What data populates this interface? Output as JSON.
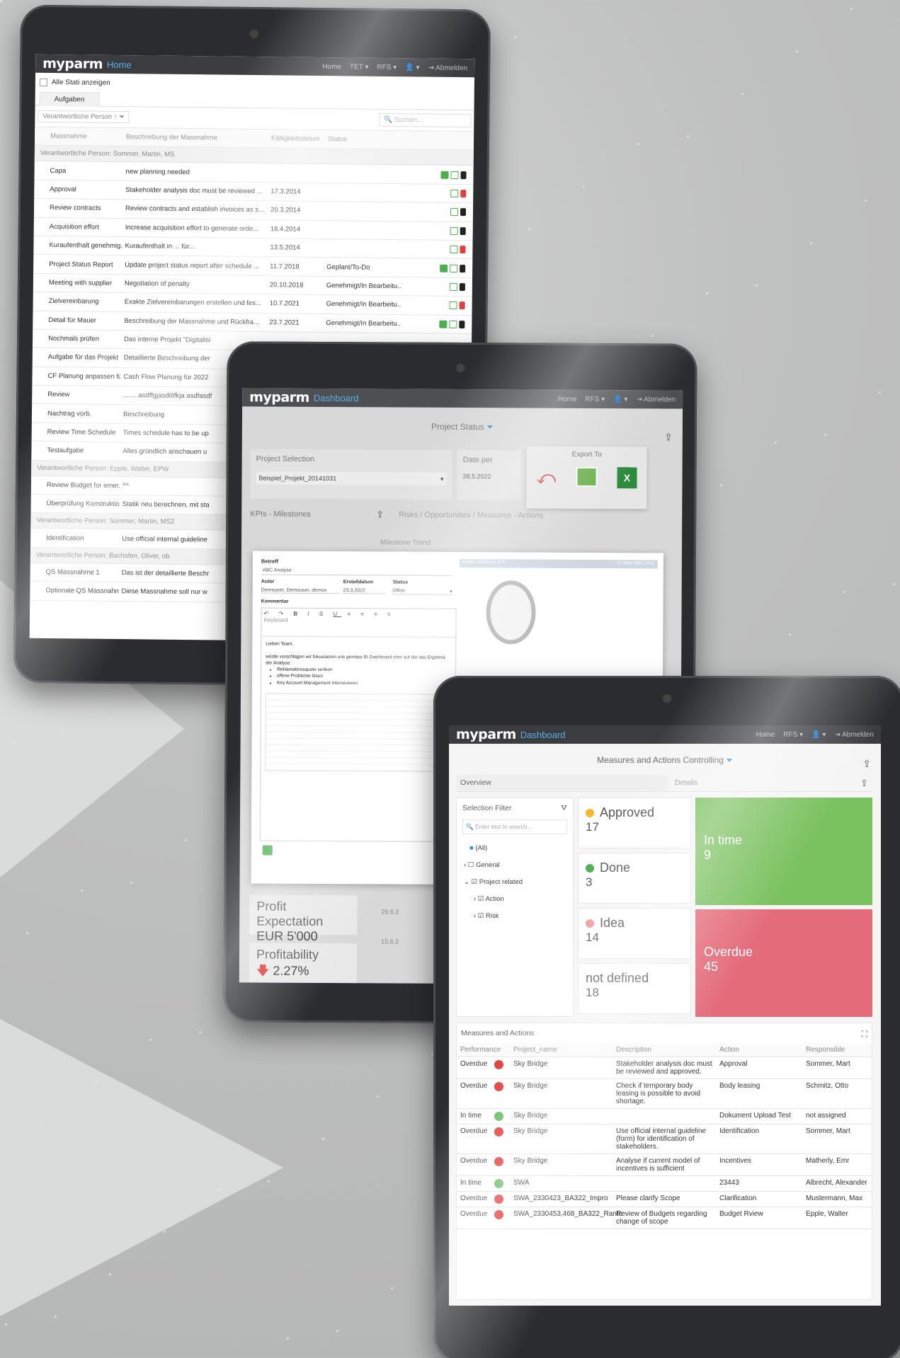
{
  "brand": {
    "logo": "myparm"
  },
  "tablet1": {
    "title": "Home",
    "nav": [
      "Home",
      "TET ▾",
      "RFS ▾",
      "👤 ▾",
      "⇥ Abmelden"
    ],
    "show_all": "Alle Stati anzeigen",
    "tab": "Aufgaben",
    "group_by": "Verantwortliche Person",
    "search_placeholder": "Suchen...",
    "columns": [
      "Massnahme",
      "Beschreibung der Massnahme",
      "Fälligkeitsdatum",
      "Status"
    ],
    "groups": [
      {
        "label": "Verantwortliche Person: Sommer, Martin, MS",
        "rows": [
          [
            "Capa",
            "new planning needed",
            "",
            ""
          ],
          [
            "Approval",
            "Stakeholder analysis doc must be reviewed ...",
            "17.3.2014",
            ""
          ],
          [
            "Review contracts",
            "Review contracts and establish invoices as s...",
            "20.3.2014",
            ""
          ],
          [
            "Acquisition effort",
            "Increase acquisition effort to generate orde...",
            "18.4.2014",
            ""
          ],
          [
            "Kuraufenthalt genehmig...",
            "Kuraufenthalt in ... für...",
            "13.5.2014",
            ""
          ],
          [
            "Project Status Report",
            "Update project status report after schedule ...",
            "11.7.2018",
            "Geplant/To-Do"
          ],
          [
            "Meeting with supplier",
            "Negotiation of penalty",
            "20.10.2018",
            "Genehmigt/In Bearbeitu..."
          ],
          [
            "Zielvereinbarung",
            "Exakte Zielvereinbarungen erstellen und fes...",
            "10.7.2021",
            "Genehmigt/In Bearbeitu..."
          ],
          [
            "Detail für Mauer",
            "Beschreibung der Massnahme und Rückfra...",
            "23.7.2021",
            "Genehmigt/In Bearbeitu..."
          ],
          [
            "Nochmals prüfen",
            "Das interne Projekt \"Digitalisi",
            "",
            ""
          ],
          [
            "Aufgabe für das Projekt",
            "Detaillierte Beschreibung der",
            "",
            ""
          ],
          [
            "CF Planung anpassen fü...",
            "Cash Flow Planung für 2022",
            "",
            ""
          ],
          [
            "Review",
            "........asdffgjasdölfkja asdfasdf",
            "",
            ""
          ],
          [
            "Nachtrag vorb.",
            "Beschreibung",
            "",
            ""
          ],
          [
            "Review Time Schedule",
            "Times schedule has to be up",
            "",
            ""
          ],
          [
            "Testaufgabe",
            "Alles gründlich anschauen u",
            "",
            ""
          ]
        ]
      },
      {
        "label": "Verantwortliche Person: Epple, Walter, EPW",
        "rows": [
          [
            "Review Budget for emer...",
            "^^",
            "",
            ""
          ],
          [
            "Überprüfung Konstruktion",
            "Statik neu berechnen, mit sta",
            "",
            ""
          ]
        ]
      },
      {
        "label": "Verantwortliche Person: Sommer, Martin, MS2",
        "rows": [
          [
            "Identification",
            "Use official internal guideline",
            "",
            ""
          ]
        ]
      },
      {
        "label": "Verantwortliche Person: Bachofen, Oliver, ob",
        "rows": [
          [
            "QS Massnahme 1",
            "Das ist der detaillierte Beschr",
            "",
            ""
          ],
          [
            "Optionale QS Massnahme",
            "Diese Massnahme soll nur w",
            "",
            ""
          ]
        ]
      }
    ]
  },
  "tablet2": {
    "title": "Dashboard",
    "nav": [
      "Home",
      "RFS ▾",
      "👤 ▾",
      "⇥ Abmelden"
    ],
    "heading": "Project Status",
    "project_selection_label": "Project Selection",
    "project_value": "Beispiel_Projekt_20141031",
    "date_label": "Date per",
    "date_value": "28.5.2022",
    "export_label": "Export To",
    "kpi_label": "KPIs - Milestones",
    "risks_label": "Risks / Opportunities / Measures - Actions",
    "trend_label": "Milestone Trend",
    "form": {
      "betreff_label": "Betreff",
      "betreff_value": "ABC Analyse",
      "autor_label": "Autor",
      "autor_value": "Demouser, Demouser, demox",
      "datum_label": "Erstelldatum",
      "datum_value": "23.3.2022",
      "status_label": "Status",
      "status_value": "Offen",
      "kommentar_label": "Kommentar",
      "keyboard": "Keyboard",
      "text_greeting": "Lieben Team,",
      "text_body": "würde vorschlagen wir fokussieren uns gemäss BI Dashboard eher auf die das Ergebnis der Analyse:",
      "bullets": [
        "Reklamationsquote senken",
        "offene Probleme lösen",
        "Key Account Management intensivieren"
      ]
    },
    "image_caption": "Pfeiffer, Elisabeth, EPF",
    "image_date": "21 März 2022 14:41",
    "profit_label": "Profit Expectation",
    "profit_value": "EUR 5'000",
    "profitability_label": "Profitability",
    "profitability_value": "2.27%",
    "side_dates": [
      "29.6.2",
      "15.6.2"
    ]
  },
  "tablet3": {
    "title": "Dashboard",
    "nav": [
      "Home",
      "RFS ▾",
      "👤 ▾",
      "⇥ Abmelden"
    ],
    "heading": "Measures and Actions Controlling",
    "tab_overview": "Overview",
    "tab_details": "Details",
    "filter_label": "Selection Filter",
    "search_placeholder": "Enter text to search...",
    "tree": [
      "(All)",
      "General",
      "Project related",
      "Action",
      "Risk"
    ],
    "kpis": [
      {
        "label": "Approved",
        "value": "17",
        "color": "#f5b82e"
      },
      {
        "label": "Done",
        "value": "3",
        "color": "#4caf50"
      },
      {
        "label": "Idea",
        "value": "14",
        "color": "#f09aa0"
      },
      {
        "label": "not defined",
        "value": "18",
        "color": ""
      }
    ],
    "tiles": [
      {
        "label": "In time",
        "value": "9",
        "color": "#7ac15f"
      },
      {
        "label": "Overdue",
        "value": "45",
        "color": "#e46c7a"
      }
    ],
    "table_title": "Measures and Actions",
    "columns": [
      "Performance",
      "Project_name",
      "Description",
      "Action",
      "Responsible"
    ],
    "rows": [
      {
        "perf": "Overdue",
        "color": "#e03030",
        "project": "Sky Bridge",
        "desc": "Stakeholder analysis doc must be reviewed and approved.",
        "action": "Approval",
        "resp": "Sommer, Mart"
      },
      {
        "perf": "Overdue",
        "color": "#e03030",
        "project": "Sky Bridge",
        "desc": "Check if temporary body leasing is possible to avoid shortage.",
        "action": "Body leasing",
        "resp": "Schmitz, Otto"
      },
      {
        "perf": "In time",
        "color": "#5cb85c",
        "project": "Sky Bridge",
        "desc": "",
        "action": "Dokument Upload Test",
        "resp": "not assigned"
      },
      {
        "perf": "Overdue",
        "color": "#e03030",
        "project": "Sky Bridge",
        "desc": "Use official internal guideline (form) for identification of stakeholders.",
        "action": "Identification",
        "resp": "Sommer, Mart"
      },
      {
        "perf": "Overdue",
        "color": "#e03030",
        "project": "Sky Bridge",
        "desc": "Analyse if current model of incentives is sufficient",
        "action": "Incentives",
        "resp": "Matherly, Emr"
      },
      {
        "perf": "In time",
        "color": "#5cb85c",
        "project": "SWA",
        "desc": "",
        "action": "23443",
        "resp": "Albrecht, Alexander"
      },
      {
        "perf": "Overdue",
        "color": "#e03030",
        "project": "SWA_2330423_BA322_Impro",
        "desc": "Please clarify Scope",
        "action": "Clarification",
        "resp": "Mustermann, Max"
      },
      {
        "perf": "Overdue",
        "color": "#e03030",
        "project": "SWA_2330453,468_BA322_Ranto",
        "desc": "Review of Budgets regarding change of scope",
        "action": "Budget Rview",
        "resp": "Epple, Walter"
      }
    ]
  }
}
